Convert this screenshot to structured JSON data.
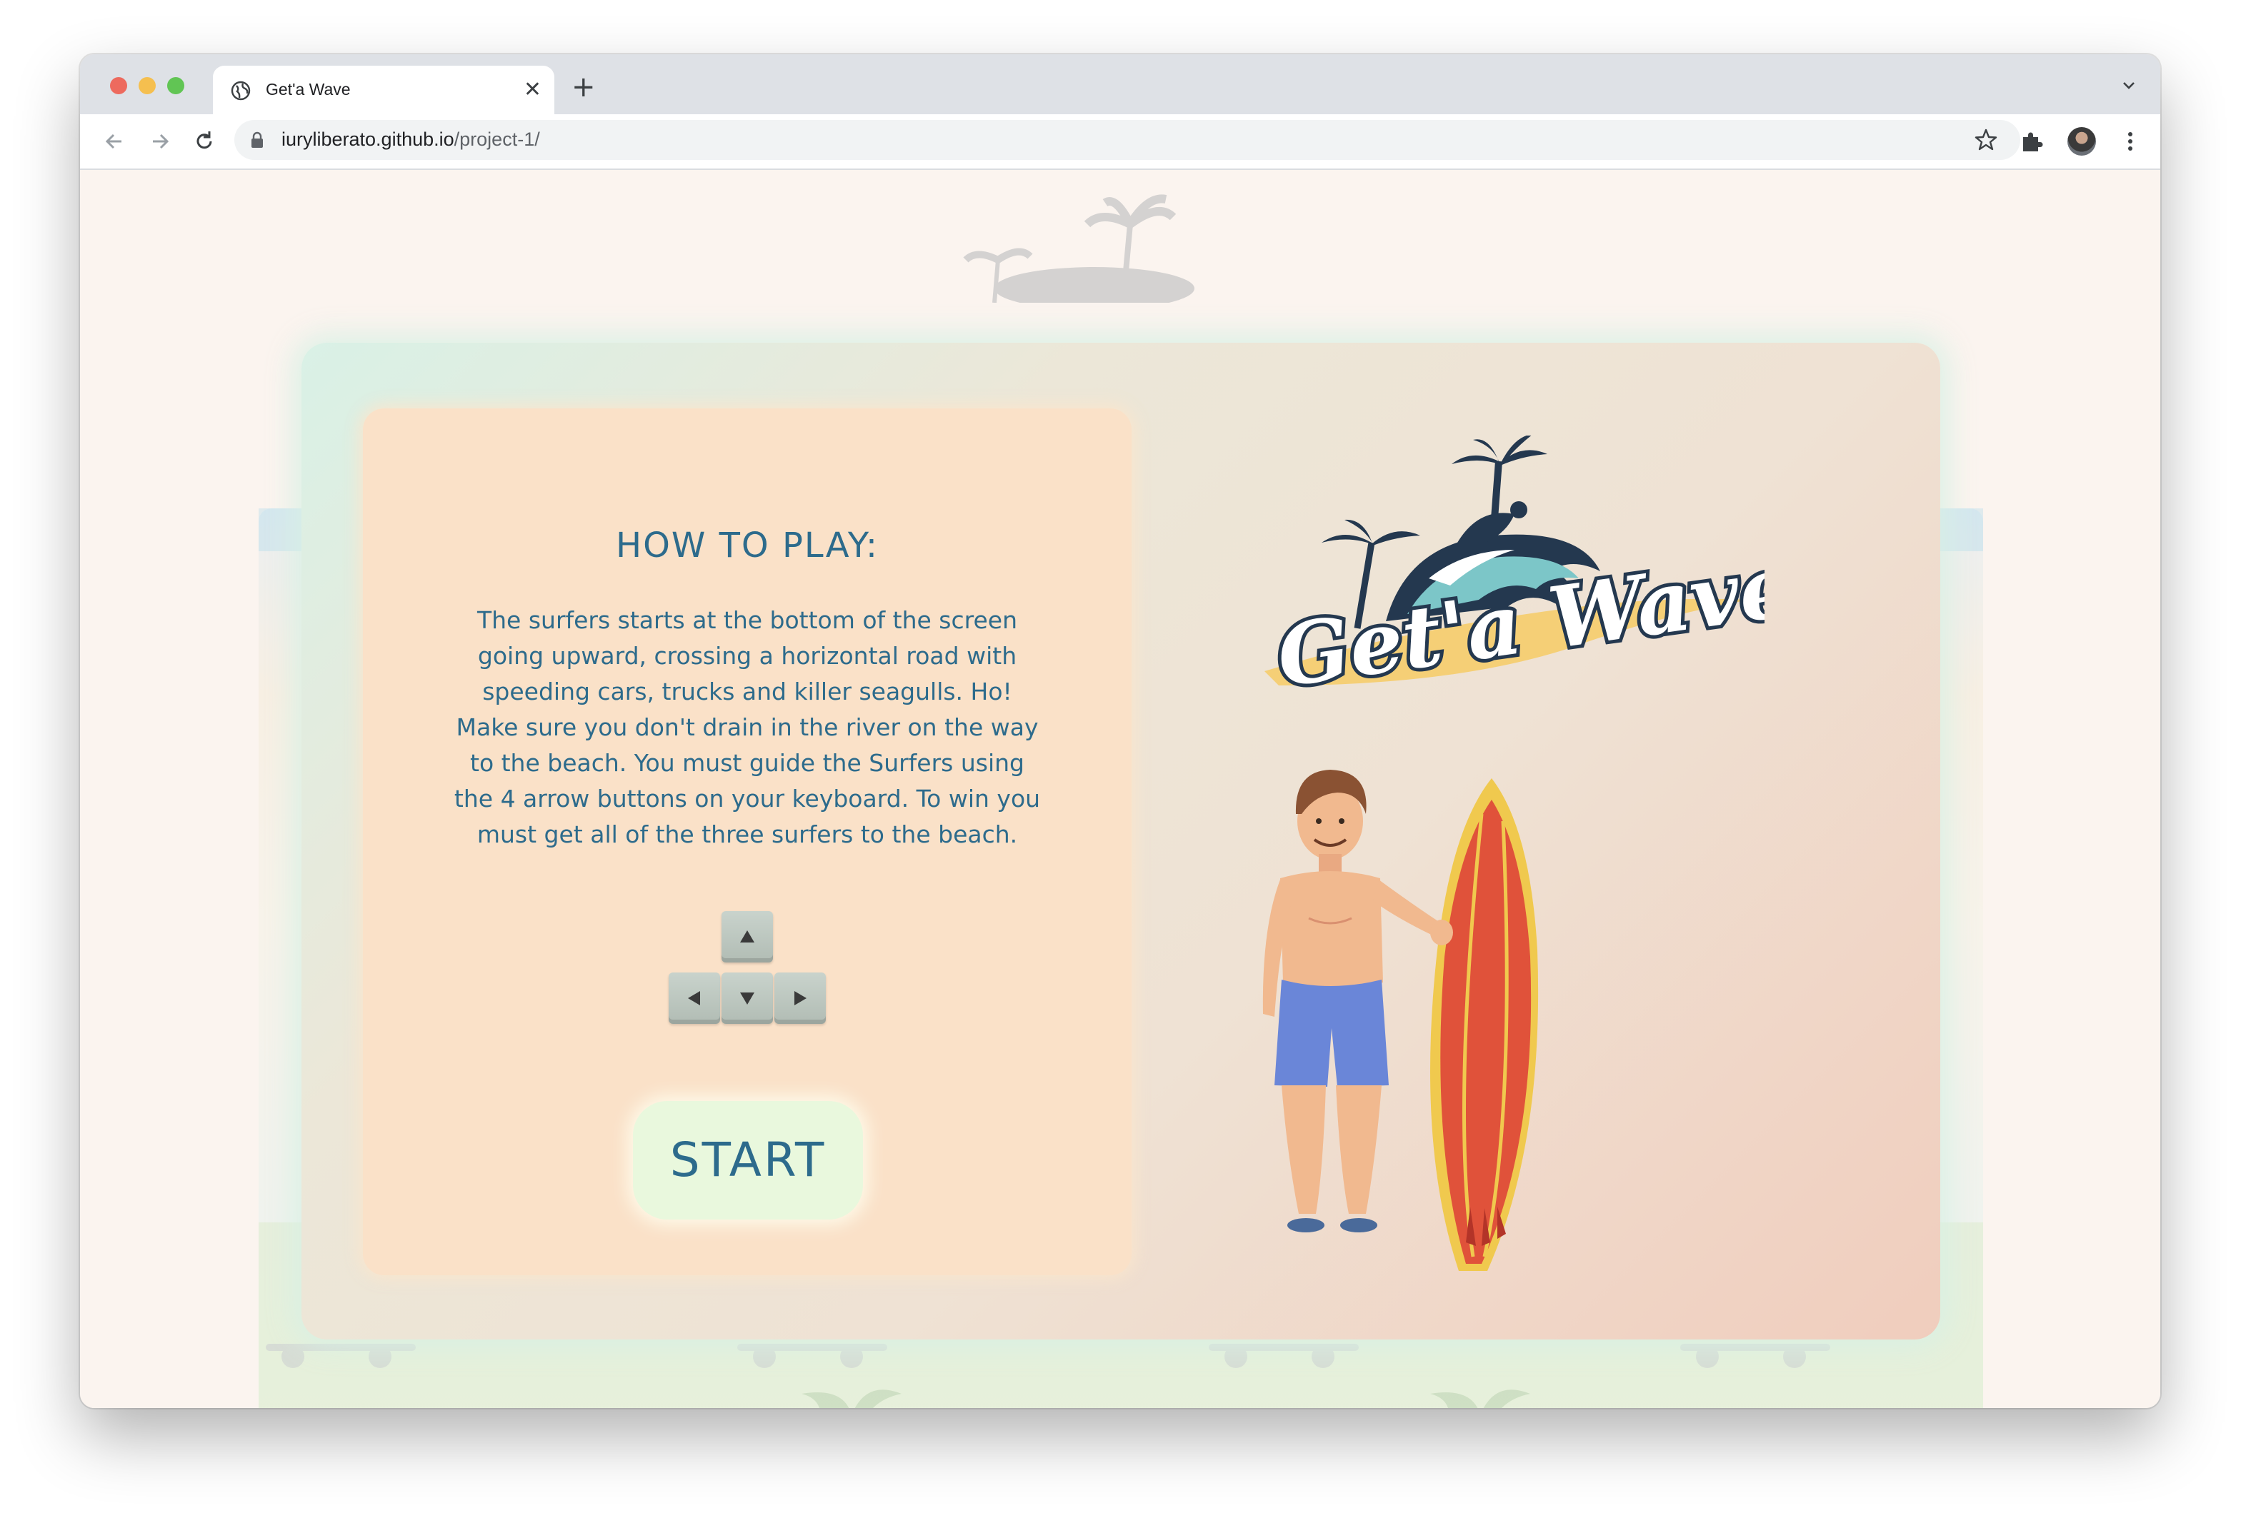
{
  "browser": {
    "tab_title": "Get'a Wave",
    "tab_close": "✕",
    "new_tab": "+",
    "url_host": "iuryliberato.github.io",
    "url_path": "/project-1/"
  },
  "game": {
    "howto_title": "HOW TO PLAY:",
    "howto_text": "The surfers starts at the bottom of the screen going upward, crossing a horizontal road with speeding cars, trucks and killer seagulls. Ho! Make sure you don't drain in the river on the way to the beach. You must guide the Surfers using the 4 arrow buttons on your keyboard. To win you must get all of the three surfers to the beach.",
    "keys": [
      "up",
      "left",
      "down",
      "right"
    ],
    "start_label": "START",
    "logo_text": "Get'a Wave"
  },
  "colors": {
    "text": "#2d6b8c",
    "panel": "#fae1c8",
    "start_button": "#e9f8dd",
    "surfboard": "#e0523a",
    "shorts": "#6a86d8"
  }
}
